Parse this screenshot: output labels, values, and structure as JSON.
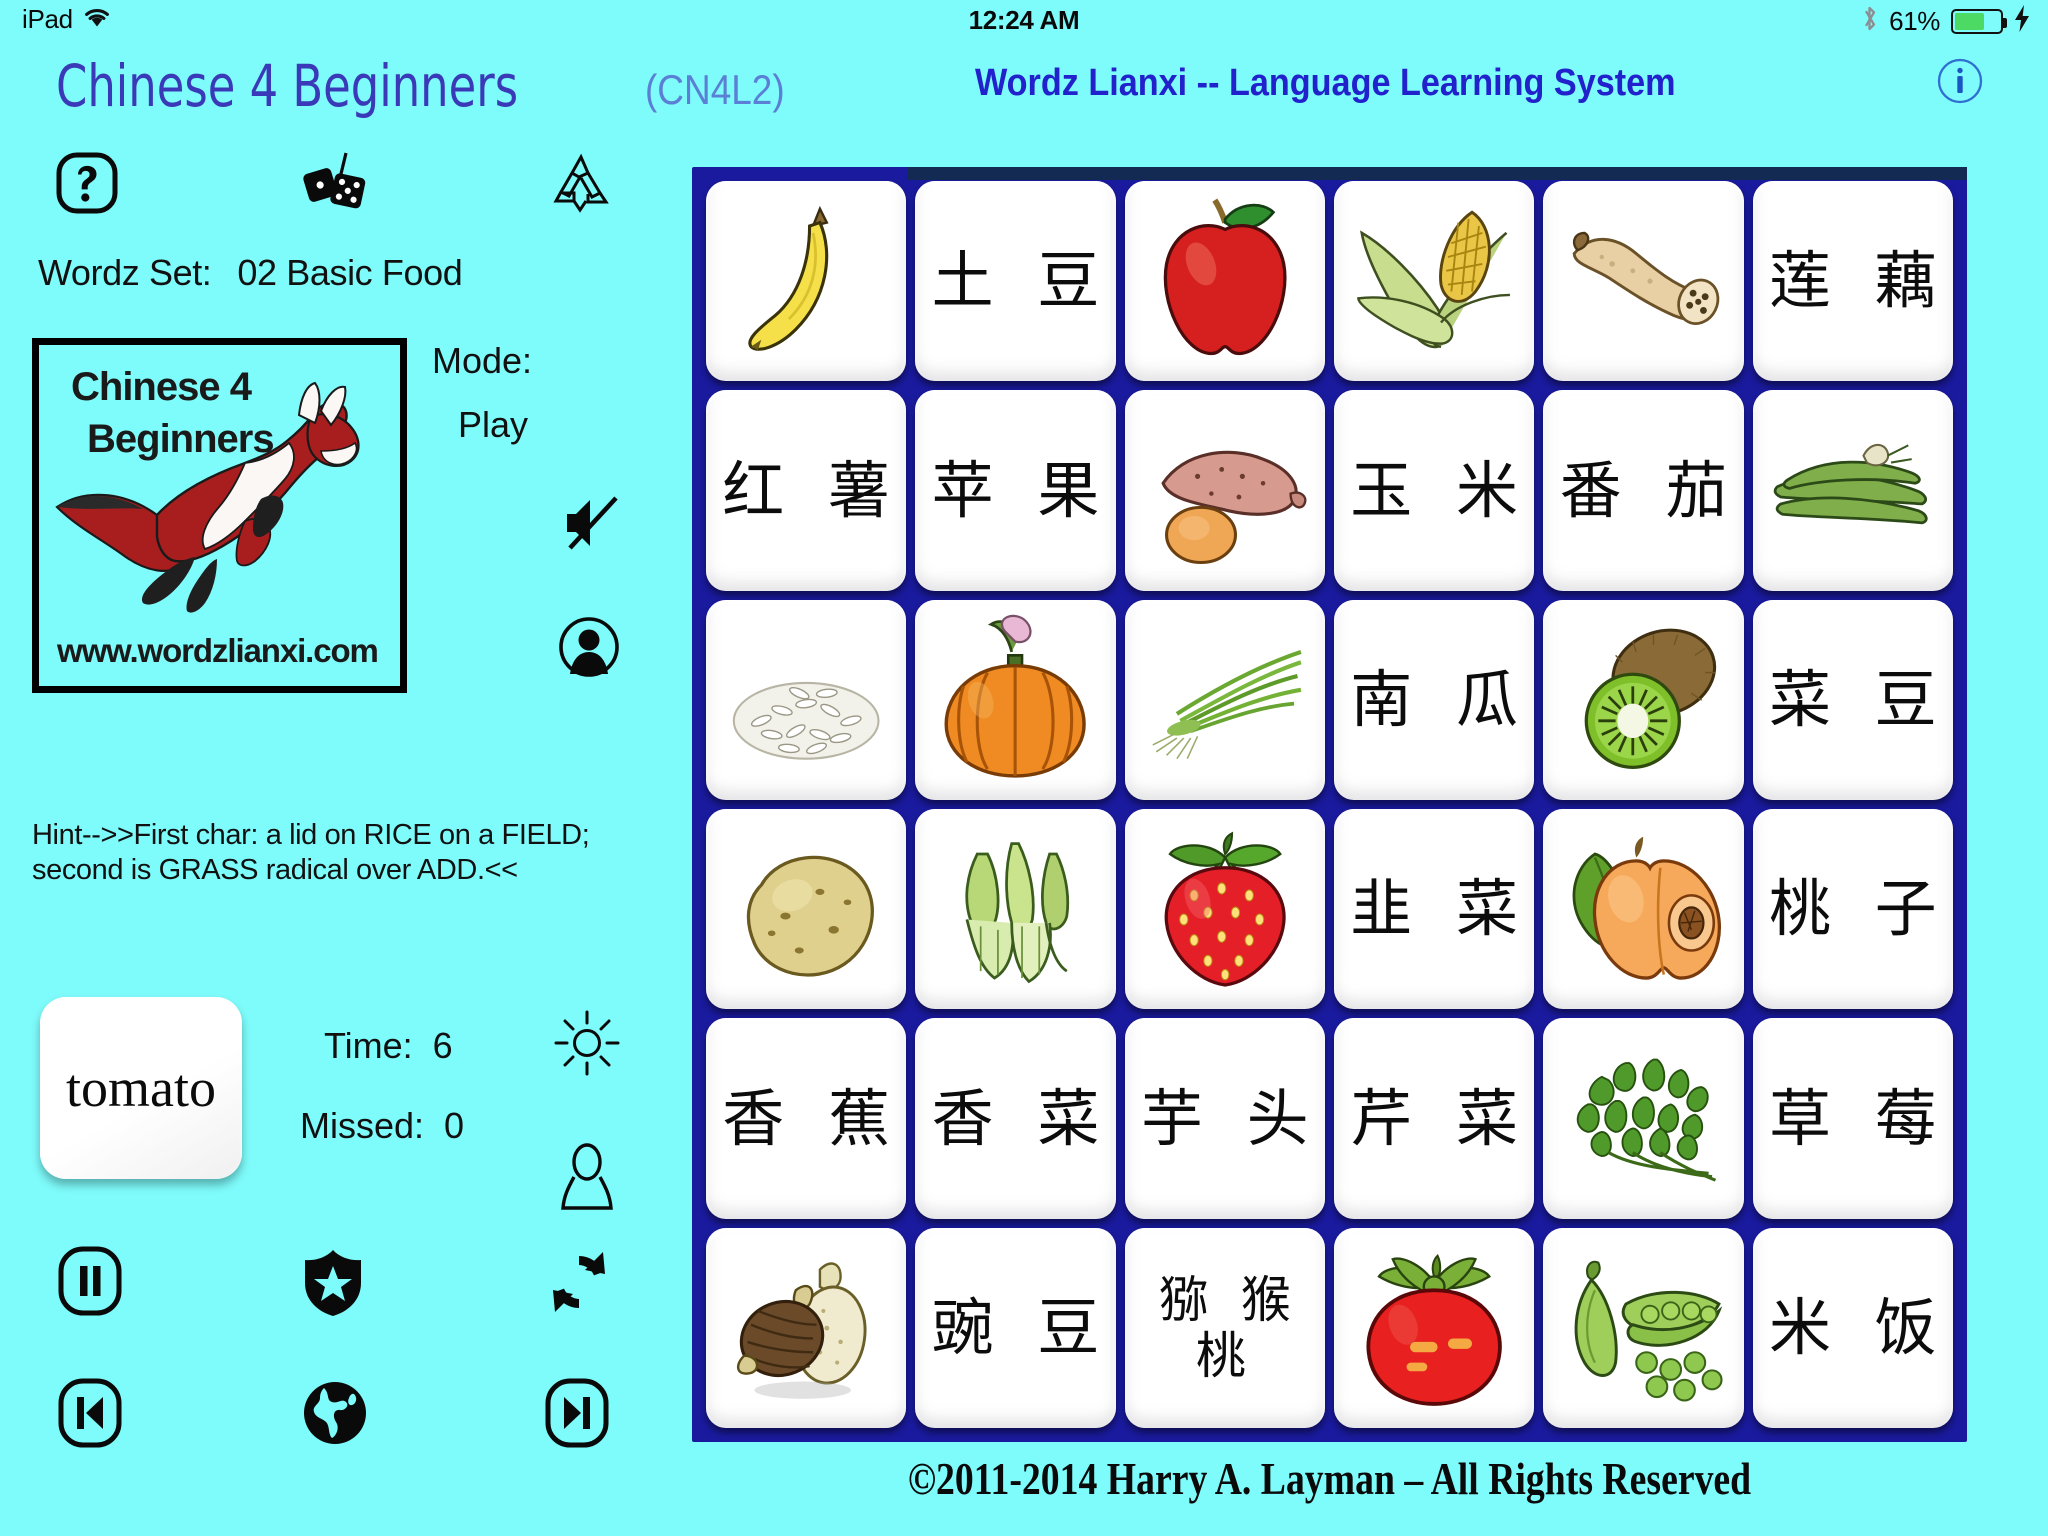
{
  "status_bar": {
    "device": "iPad",
    "wifi_icon": "wifi-icon",
    "time": "12:24 AM",
    "bluetooth_icon": "bluetooth-icon",
    "battery_percent": "61%",
    "battery_level": 61,
    "charging_icon": "lightning-bolt-icon"
  },
  "header": {
    "app_title": "Chinese 4 Beginners",
    "app_code": "(CN4L2)",
    "system_title": "Wordz Lianxi -- Language Learning System",
    "info_icon": "info-circle-icon",
    "title_color": "#3a3ab8",
    "code_color": "#5b7fd4",
    "system_title_color": "#2222cc"
  },
  "toolbar": {
    "help_icon": "question-mark-icon",
    "dice_icon": "dice-icon",
    "recycle_icon": "recycle-icon"
  },
  "sidebar": {
    "wordz_set_label": "Wordz Set:",
    "wordz_set_value": "02 Basic Food",
    "mode_label": "Mode:",
    "mode_value": "Play",
    "mute_icon": "speaker-muted-icon",
    "profile_icon": "person-circle-icon",
    "brightness_icon": "sun-brightness-icon",
    "user_outline_icon": "person-outline-icon"
  },
  "logo": {
    "line1": "Chinese 4",
    "line2": "Beginners",
    "url": "www.wordzlianxi.com",
    "art": "leaping-fox-illustration",
    "bg_color": "#7efbfb",
    "border_color": "#000000",
    "fox_color": "#a81e1e"
  },
  "hint": {
    "text": "Hint-->>First char: a lid on RICE on a FIELD; second is GRASS radical over ADD.<<"
  },
  "current_word": {
    "label": "tomato"
  },
  "stats": {
    "time_label": "Time:",
    "time_value": "6",
    "missed_label": "Missed:",
    "missed_value": "0"
  },
  "controls": {
    "pause_icon": "pause-button-icon",
    "shield_star_icon": "shield-star-icon",
    "refresh_icon": "refresh-sync-icon",
    "prev_icon": "previous-track-icon",
    "globe_icon": "globe-icon",
    "next_icon": "next-track-icon"
  },
  "board": {
    "bg_color": "#1a1a9e",
    "tile_color": "#ffffff",
    "rows": 6,
    "cols": 6,
    "tiles": [
      {
        "type": "image",
        "image": "banana-illustration",
        "alt": "banana"
      },
      {
        "type": "text",
        "text": "土 豆",
        "alt": "potato"
      },
      {
        "type": "image",
        "image": "apple-illustration",
        "alt": "apple"
      },
      {
        "type": "image",
        "image": "corn-illustration",
        "alt": "corn"
      },
      {
        "type": "image",
        "image": "lotus-root-illustration",
        "alt": "lotus root"
      },
      {
        "type": "text",
        "text": "莲 藕",
        "alt": "lotus root"
      },
      {
        "type": "text",
        "text": "红 薯",
        "alt": "sweet potato"
      },
      {
        "type": "text",
        "text": "苹 果",
        "alt": "apple"
      },
      {
        "type": "image",
        "image": "sweet-potato-illustration",
        "alt": "sweet potato"
      },
      {
        "type": "text",
        "text": "玉 米",
        "alt": "corn"
      },
      {
        "type": "text",
        "text": "番 茄",
        "alt": "tomato"
      },
      {
        "type": "image",
        "image": "green-beans-illustration",
        "alt": "green beans"
      },
      {
        "type": "image",
        "image": "rice-grains-illustration",
        "alt": "rice"
      },
      {
        "type": "image",
        "image": "pumpkin-illustration",
        "alt": "pumpkin"
      },
      {
        "type": "image",
        "image": "chives-illustration",
        "alt": "chives"
      },
      {
        "type": "text",
        "text": "南 瓜",
        "alt": "pumpkin"
      },
      {
        "type": "image",
        "image": "kiwi-illustration",
        "alt": "kiwi"
      },
      {
        "type": "text",
        "text": "菜 豆",
        "alt": "green beans"
      },
      {
        "type": "image",
        "image": "potato-illustration",
        "alt": "potato"
      },
      {
        "type": "image",
        "image": "celery-illustration",
        "alt": "celery"
      },
      {
        "type": "image",
        "image": "strawberry-illustration",
        "alt": "strawberry"
      },
      {
        "type": "text",
        "text": "韭 菜",
        "alt": "chives"
      },
      {
        "type": "image",
        "image": "peach-illustration",
        "alt": "peach"
      },
      {
        "type": "text",
        "text": "桃 子",
        "alt": "peach"
      },
      {
        "type": "text",
        "text": "香 蕉",
        "alt": "banana"
      },
      {
        "type": "text",
        "text": "香 菜",
        "alt": "cilantro"
      },
      {
        "type": "text",
        "text": "芋 头",
        "alt": "taro"
      },
      {
        "type": "text",
        "text": "芹 菜",
        "alt": "celery"
      },
      {
        "type": "image",
        "image": "cilantro-illustration",
        "alt": "cilantro"
      },
      {
        "type": "text",
        "text": "草 莓",
        "alt": "strawberry"
      },
      {
        "type": "image",
        "image": "taro-illustration",
        "alt": "taro"
      },
      {
        "type": "text",
        "text": "豌 豆",
        "alt": "peas"
      },
      {
        "type": "text",
        "text": "猕 猴\n桃",
        "alt": "kiwi",
        "two_line": true
      },
      {
        "type": "image",
        "image": "tomato-illustration",
        "alt": "tomato"
      },
      {
        "type": "image",
        "image": "peas-illustration",
        "alt": "peas"
      },
      {
        "type": "text",
        "text": "米 饭",
        "alt": "cooked rice"
      }
    ]
  },
  "footer": {
    "copyright": "©2011-2014 Harry A. Layman – All Rights Reserved"
  }
}
